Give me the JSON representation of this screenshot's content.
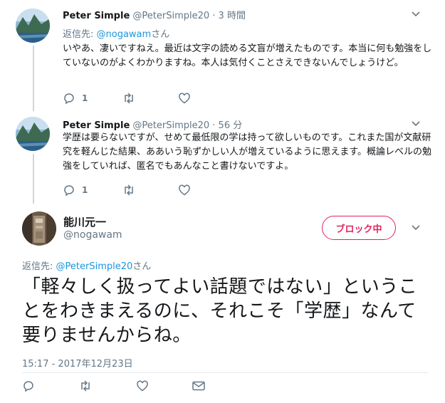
{
  "tweets": [
    {
      "name": "Peter Simple",
      "handle": "@PeterSimple20",
      "time": "· 3 時間",
      "reply_prefix": "返信先: ",
      "reply_to": "@nogawam",
      "reply_suffix": "さん",
      "text": "いやあ、凄いですねえ。最近は文字の読める文盲が増えたものです。本当に何も勉強をしていないのがよくわかりますね。本人は気付くことさえできないんでしょうけど。",
      "reply_count": "1"
    },
    {
      "name": "Peter Simple",
      "handle": "@PeterSimple20",
      "time": "· 56 分",
      "text": "学歴は要らないですが、せめて最低限の学は持って欲しいものです。これまた国が文献研究を軽んじた結果、ああいう恥ずかしい人が増えているように思えます。概論レベルの勉強をしていれば、匿名でもあんなこと書けないですよ。",
      "reply_count": "1"
    }
  ],
  "main_tweet": {
    "name": "能川元一",
    "handle": "@nogawam",
    "block_label": "ブロック中",
    "reply_prefix": "返信先: ",
    "reply_to": "@PeterSimple20",
    "reply_suffix": "さん",
    "text": "「軽々しく扱ってよい話題ではない」ということをわきまえるのに、それこそ「学歴」なんて要りませんからね。",
    "timestamp": "15:17 - 2017年12月23日"
  },
  "icons": {
    "reply": "reply-icon",
    "retweet": "retweet-icon",
    "like": "heart-icon",
    "dm": "envelope-icon",
    "more": "chevron-down-icon"
  },
  "colors": {
    "link": "#1b95e0",
    "block": "#e0245e",
    "muted": "#657786"
  }
}
